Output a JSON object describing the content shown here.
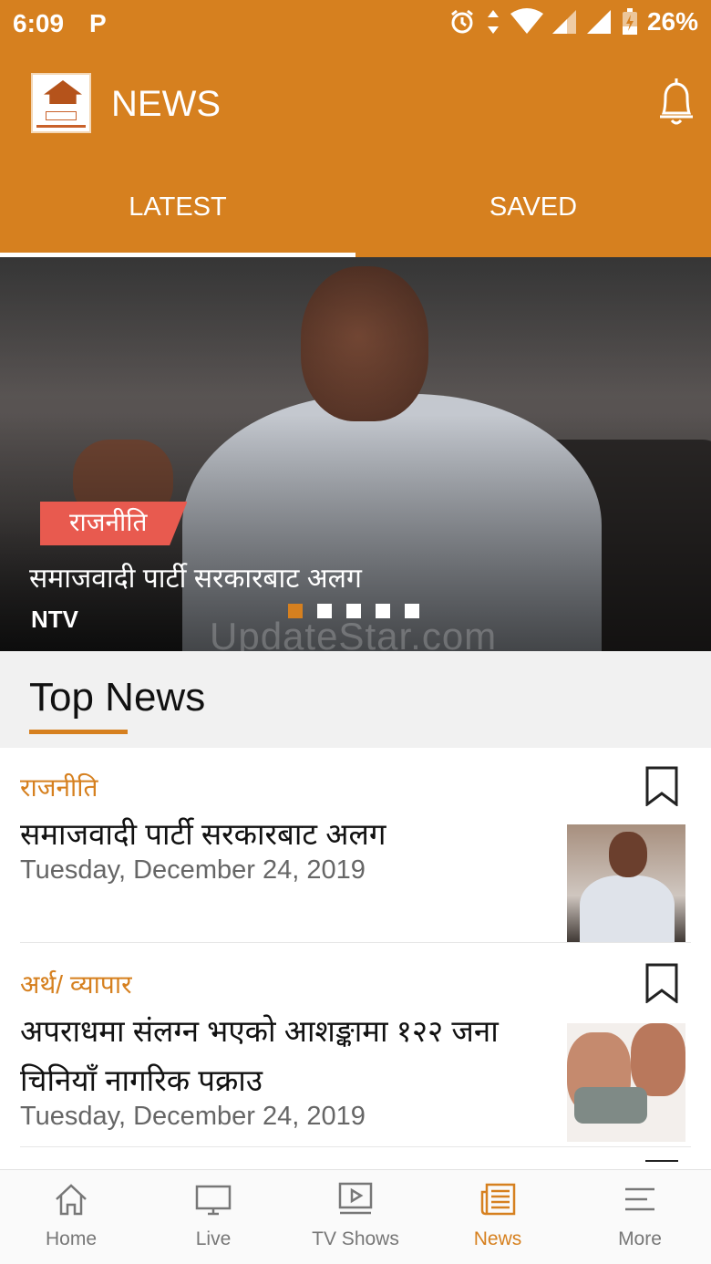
{
  "status_bar": {
    "time": "6:09",
    "p_icon": "P",
    "battery_pct": "26%",
    "icons": [
      "alarm-icon",
      "data-arrows-icon",
      "wifi-icon",
      "signal-icon",
      "signal-icon",
      "battery-charging-icon"
    ]
  },
  "app_bar": {
    "title": "NEWS",
    "logo": "nepal-television-logo",
    "notification_icon": "bell-icon"
  },
  "tabs": [
    {
      "label": "LATEST",
      "active": true
    },
    {
      "label": "SAVED",
      "active": false
    }
  ],
  "hero": {
    "category": "राजनीति",
    "headline": "समाजवादी पार्टी सरकारबाट अलग",
    "source": "NTV",
    "slide_count": 5,
    "active_slide": 1,
    "watermark": "UpdateStar.com"
  },
  "section": {
    "heading": "Top News"
  },
  "news": [
    {
      "category": "राजनीति",
      "title": "समाजवादी पार्टी सरकारबाट अलग",
      "date": "Tuesday, December 24, 2019"
    },
    {
      "category": "अर्थ/ व्यापार",
      "title": "अपराधमा संलग्न भएको आशङ्कामा १२२ जना चिनियाँ नागरिक पक्राउ",
      "date": "Tuesday, December 24, 2019"
    }
  ],
  "bottom_nav": [
    {
      "label": "Home",
      "icon": "home-icon",
      "active": false
    },
    {
      "label": "Live",
      "icon": "monitor-icon",
      "active": false
    },
    {
      "label": "TV Shows",
      "icon": "play-screen-icon",
      "active": false
    },
    {
      "label": "News",
      "icon": "newspaper-icon",
      "active": true
    },
    {
      "label": "More",
      "icon": "menu-lines-icon",
      "active": false
    }
  ],
  "colors": {
    "primary": "#d6801f",
    "tag": "#e85a4f",
    "text": "#111111",
    "muted": "#666666"
  }
}
